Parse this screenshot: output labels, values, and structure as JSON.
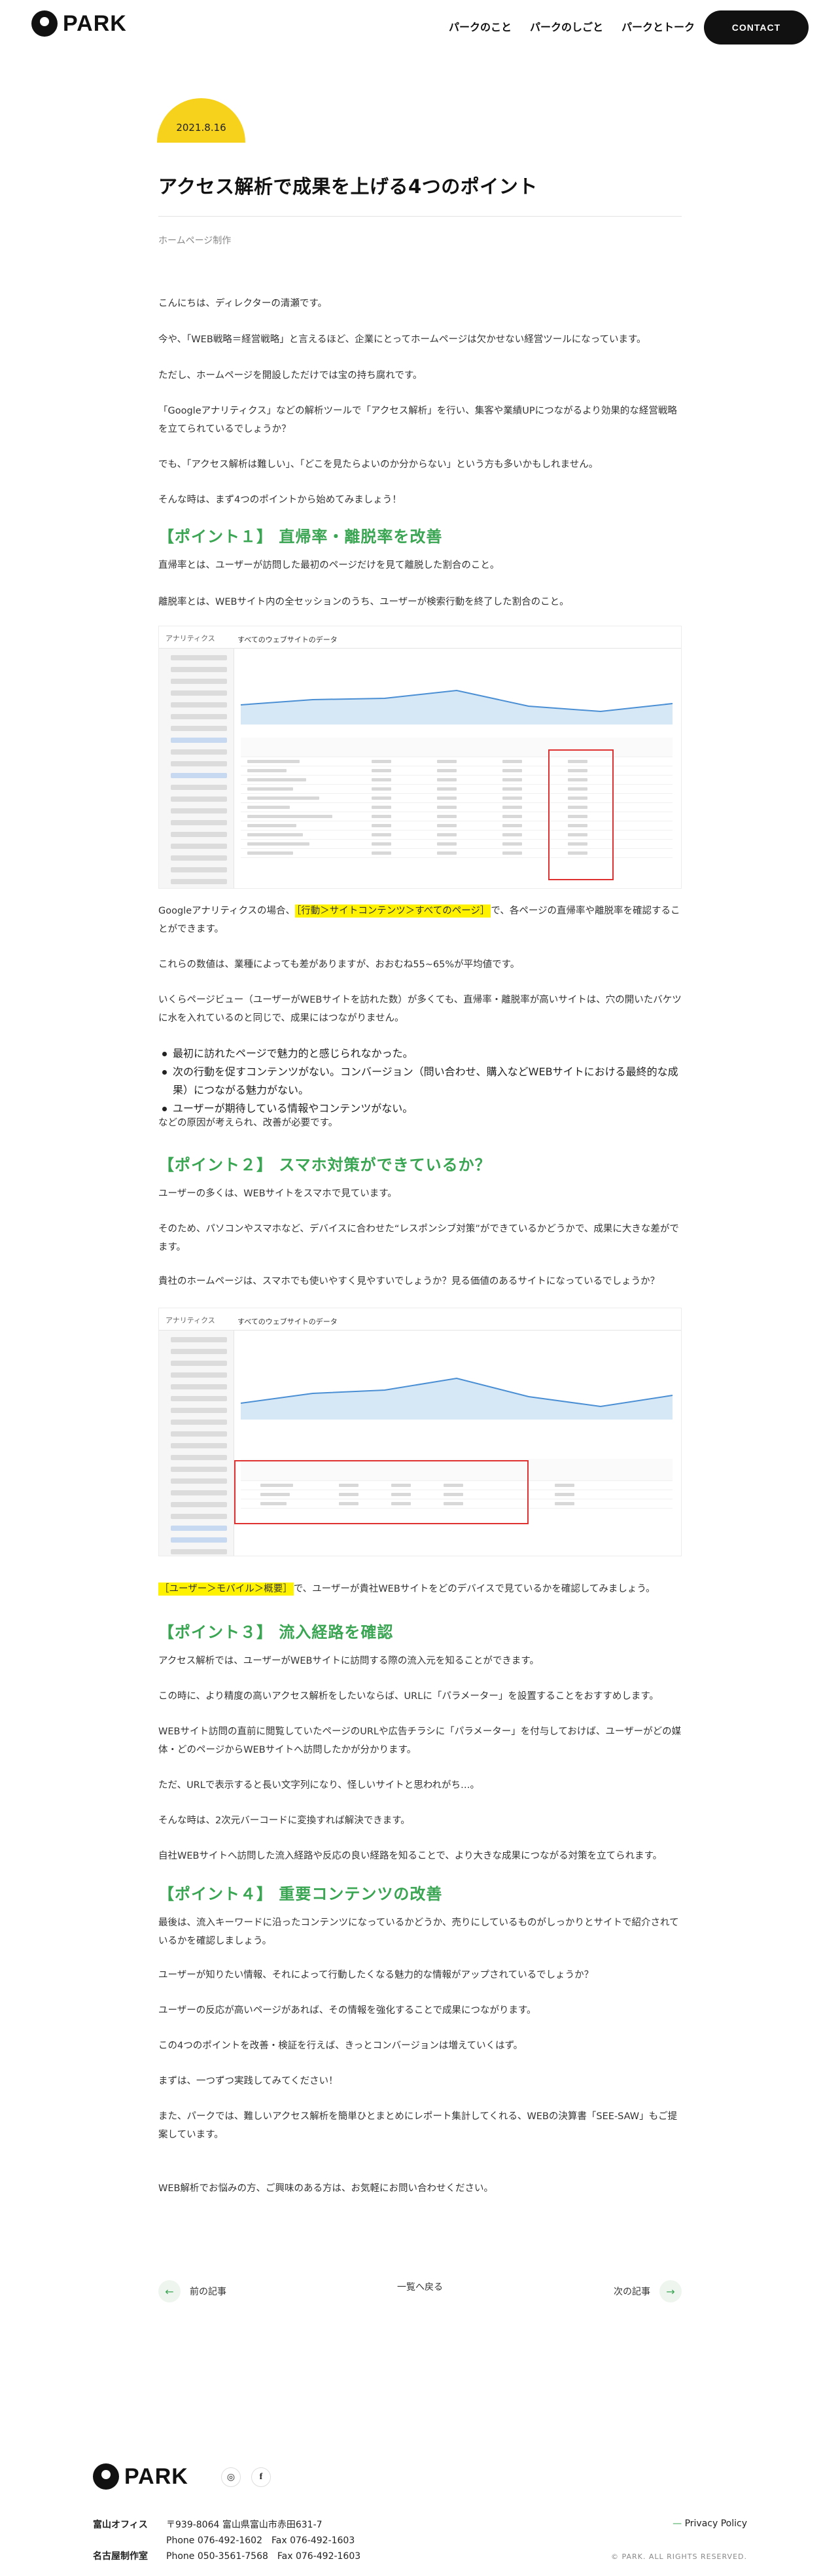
{
  "header": {
    "logo": "PARK",
    "nav": [
      "パークのこと",
      "パークのしごと",
      "パークとトーク"
    ],
    "contact": "CONTACT"
  },
  "post": {
    "date": "2021.8.16",
    "title": "アクセス解析で成果を上げる4つのポイント",
    "category": "ホームページ制作"
  },
  "article": {
    "p1": "こんにちは、ディレクターの清瀬です。",
    "p2": "今や、「WEB戦略＝経営戦略」と言えるほど、企業にとってホームページは欠かせない経営ツールになっています。",
    "p3": "ただし、ホームページを開設しただけでは宝の持ち腐れです。",
    "p4": "「Googleアナリティクス」などの解析ツールで「アクセス解析」を行い、集客や業績UPにつながるより効果的な経営戦略を立てられているでしょうか？",
    "p5": "でも、「アクセス解析は難しい」、「どこを見たらよいのか分からない」という方も多いかもしれません。",
    "p6": "そんな時は、まず4つのポイントから始めてみましょう！",
    "h1": "【ポイント１】 直帰率・離脱率を改善",
    "p7": "直帰率とは、ユーザーが訪問した最初のページだけを見て離脱した割合のこと。",
    "p8": "離脱率とは、WEBサイト内の全セッションのうち、ユーザーが検索行動を終了した割合のこと。",
    "p9a": "Googleアナリティクスの場合、",
    "p9hl": "［行動＞サイトコンテンツ＞すべてのページ］",
    "p9b": "で、各ページの直帰率や離脱率を確認することができます。",
    "p10": "これらの数値は、業種によっても差がありますが、おおむね55~65%が平均値です。",
    "p11": "いくらページビュー（ユーザーがWEBサイトを訪れた数）が多くても、直帰率・離脱率が高いサイトは、穴の開いたバケツに水を入れているのと同じで、成果にはつながりません。",
    "bullets": [
      "最初に訪れたページで魅力的と感じられなかった。",
      "次の行動を促すコンテンツがない。コンバージョン（問い合わせ、購入などWEBサイトにおける最終的な成果）につながる魅力がない。",
      "ユーザーが期待している情報やコンテンツがない。"
    ],
    "p12": "などの原因が考えられ、改善が必要です。",
    "h2": "【ポイント２】 スマホ対策ができているか？",
    "p13": "ユーザーの多くは、WEBサイトをスマホで見ています。",
    "p14": "そのため、パソコンやスマホなど、デバイスに合わせた“レスポンシブ対策”ができているかどうかで、成果に大きな差がでます。",
    "p15": "貴社のホームページは、スマホでも使いやすく見やすいでしょうか？見る価値のあるサイトになっているでしょうか？",
    "p16hl": "［ユーザー＞モバイル＞概要］",
    "p16b": "で、ユーザーが貴社WEBサイトをどのデバイスで見ているかを確認してみましょう。",
    "h3": "【ポイント３】 流入経路を確認",
    "p17": "アクセス解析では、ユーザーがWEBサイトに訪問する際の流入元を知ることができます。",
    "p18": "この時に、より精度の高いアクセス解析をしたいならば、URLに「パラメーター」を設置することをおすすめします。",
    "p19": "WEBサイト訪問の直前に閲覧していたページのURLや広告チラシに「パラメーター」を付与しておけば、ユーザーがどの媒体・どのページからWEBサイトへ訪問したかが分かります。",
    "p20": "ただ、URLで表示すると長い文字列になり、怪しいサイトと思われがち…。",
    "p21": "そんな時は、2次元バーコードに変換すれば解決できます。",
    "p22": "自社WEBサイトへ訪問した流入経路や反応の良い経路を知ることで、より大きな成果につながる対策を立てられます。",
    "h4": "【ポイント４】 重要コンテンツの改善",
    "p23": "最後は、流入キーワードに沿ったコンテンツになっているかどうか、売りにしているものがしっかりとサイトで紹介されているかを確認しましょう。",
    "p24": "ユーザーが知りたい情報、それによって行動したくなる魅力的な情報がアップされているでしょうか？",
    "p25": "ユーザーの反応が高いページがあれば、その情報を強化することで成果につながります。",
    "p26": "この4つのポイントを改善・検証を行えば、きっとコンバージョンは増えていくはず。",
    "p27": "まずは、一つずつ実践してみてください！",
    "p28": "また、パークでは、難しいアクセス解析を簡単ひとまとめにレポート集計してくれる、WEBの決算書「SEE-SAW」もご提案しています。",
    "p29": "WEB解析でお悩みの方、ご興味のある方は、お気軽にお問い合わせください。"
  },
  "screenshot1": {
    "brand": "アナリティクス",
    "site": "すべてのウェブサイトのデータ"
  },
  "screenshot2": {
    "brand": "アナリティクス",
    "site": "すべてのウェブサイトのデータ"
  },
  "pager": {
    "prev": "前の記事",
    "back": "一覧へ戻る",
    "next": "次の記事"
  },
  "footer": {
    "logo": "PARK",
    "social": [
      "instagram-icon",
      "facebook-icon"
    ],
    "office1_name": "富山オフィス",
    "office1_addr": "〒939-8064 富山県富山市赤田631-7",
    "office1_tel": "Phone 076-492-1602　Fax 076-492-1603",
    "office2_name": "名古屋制作室",
    "office2_tel": "Phone 050-3561-7568　Fax 076-492-1603",
    "privacy": "Privacy Policy",
    "copyright": "© PARK. ALL RIGHTS RESERVED."
  },
  "colors": {
    "accent_green": "#3aa552",
    "badge_yellow": "#f6d21c",
    "highlight": "#fff200"
  }
}
